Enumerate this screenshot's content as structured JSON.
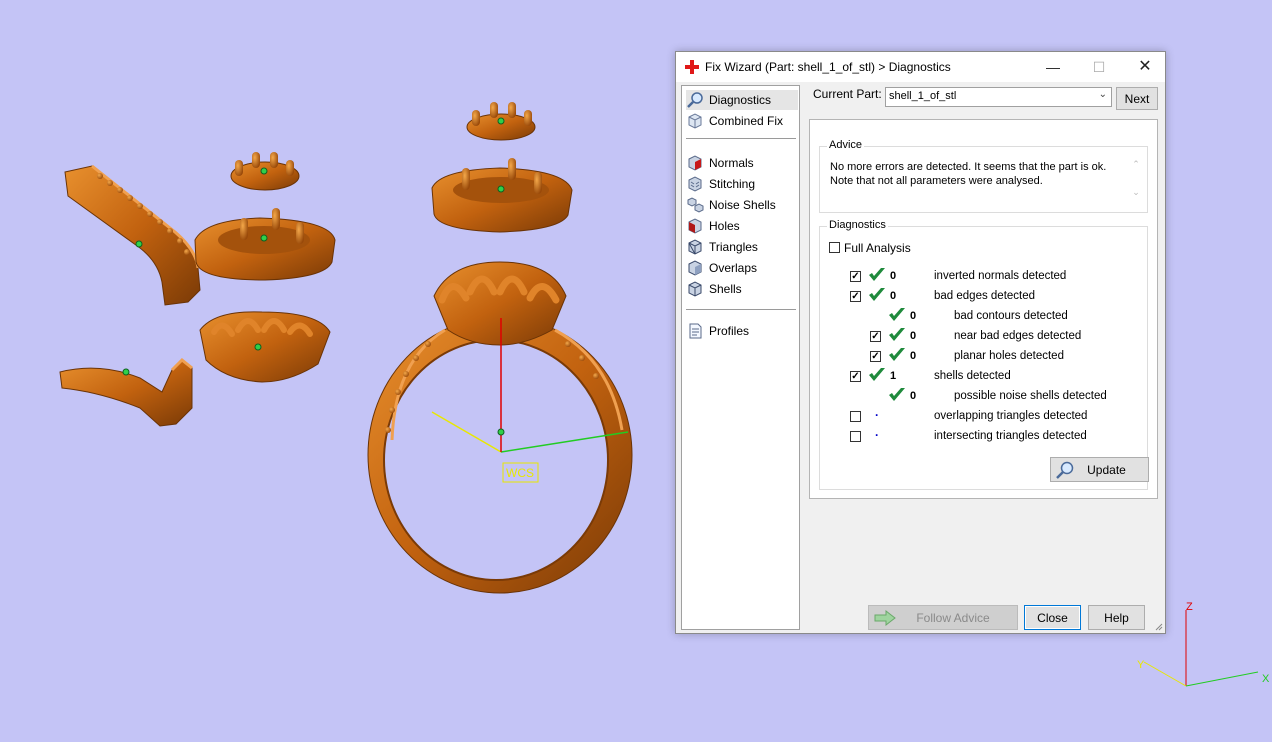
{
  "dialog": {
    "title": "Fix Wizard (Part: shell_1_of_stl) > Diagnostics",
    "minimize_glyph": "—",
    "maximize_glyph": "☐",
    "close_glyph": "✕"
  },
  "nav": {
    "items": [
      {
        "label": "Diagnostics",
        "icon": "magnifier-icon"
      },
      {
        "label": "Combined Fix",
        "icon": "cube-icon"
      },
      {
        "label": "Normals",
        "icon": "normals-cube-icon"
      },
      {
        "label": "Stitching",
        "icon": "stitching-cube-icon"
      },
      {
        "label": "Noise Shells",
        "icon": "noise-shells-icon"
      },
      {
        "label": "Holes",
        "icon": "holes-cube-icon"
      },
      {
        "label": "Triangles",
        "icon": "triangles-cube-icon"
      },
      {
        "label": "Overlaps",
        "icon": "overlaps-cube-icon"
      },
      {
        "label": "Shells",
        "icon": "shells-cube-icon"
      },
      {
        "label": "Profiles",
        "icon": "document-icon"
      }
    ]
  },
  "current_part": {
    "label": "Current Part:",
    "value": "shell_1_of_stl",
    "next_label": "Next"
  },
  "advice": {
    "title": "Advice",
    "line1": "No more errors are detected. It seems that the part is ok.",
    "line2": "Note that not all parameters were analysed."
  },
  "diagnostics": {
    "title": "Diagnostics",
    "full_analysis_label": "Full Analysis",
    "full_analysis_checked": false,
    "rows": [
      {
        "label": "inverted normals detected",
        "count": "0",
        "checked": true,
        "status": "ok"
      },
      {
        "label": "bad edges detected",
        "count": "0",
        "checked": true,
        "status": "ok"
      },
      {
        "label": "bad contours detected",
        "count": "0",
        "checked": null,
        "status": "ok"
      },
      {
        "label": "near bad edges detected",
        "count": "0",
        "checked": true,
        "status": "ok"
      },
      {
        "label": "planar holes detected",
        "count": "0",
        "checked": true,
        "status": "ok"
      },
      {
        "label": "shells detected",
        "count": "1",
        "checked": true,
        "status": "ok"
      },
      {
        "label": "possible noise shells detected",
        "count": "0",
        "checked": null,
        "status": "ok"
      },
      {
        "label": "overlapping triangles detected",
        "count": "",
        "checked": false,
        "status": "pending"
      },
      {
        "label": "intersecting triangles detected",
        "count": "",
        "checked": false,
        "status": "pending"
      }
    ],
    "update_label": "Update"
  },
  "footer": {
    "follow_advice_label": "Follow Advice",
    "close_label": "Close",
    "help_label": "Help"
  },
  "viewport": {
    "wcs_label": "WCS",
    "axis_z": "Z",
    "axis_x": "X",
    "axis_y": "Y",
    "model_color": "#c86a14",
    "background_color": "#c4c4f6"
  }
}
